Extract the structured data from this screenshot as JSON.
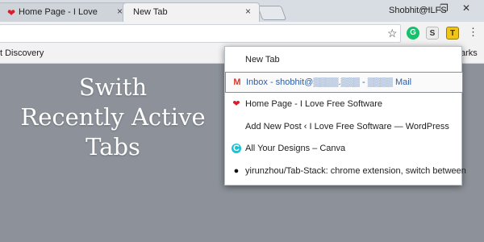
{
  "tabs": [
    {
      "title": "Home Page - I Love Free",
      "close": "×"
    },
    {
      "title": "New Tab",
      "close": "×"
    }
  ],
  "window": {
    "profile": "Shobhit@ILFS",
    "minimize": "—",
    "maximize": "❐",
    "close": "✕"
  },
  "toolbar": {
    "star": "☆",
    "ext_g": "G",
    "ext_s": "S",
    "ext_t": "T",
    "menu": "⋮"
  },
  "bookmarks": {
    "left": "t Discovery",
    "right": "arks"
  },
  "headline": {
    "line1": "Swith",
    "line2": "Recently Active",
    "line3": "Tabs"
  },
  "popup": {
    "items": [
      {
        "label": "New Tab",
        "icon": ""
      },
      {
        "label": "Inbox - shobhit@▒▒▒▒.▒▒▒ - ▒▒▒▒ Mail",
        "icon": "gmail-icon"
      },
      {
        "label": "Home Page - I Love Free Software",
        "icon": "heart-icon"
      },
      {
        "label": "Add New Post ‹ I Love Free Software — WordPress",
        "icon": ""
      },
      {
        "label": "All Your Designs – Canva",
        "icon": "canva-icon"
      },
      {
        "label": "yirunzhou/Tab-Stack: chrome extension, switch between",
        "icon": "github-icon"
      }
    ]
  },
  "colors": {
    "background": "#8d929a",
    "active_text": "#2b5da8",
    "heart": "#d81e2a",
    "canva": "#19c3d6"
  }
}
